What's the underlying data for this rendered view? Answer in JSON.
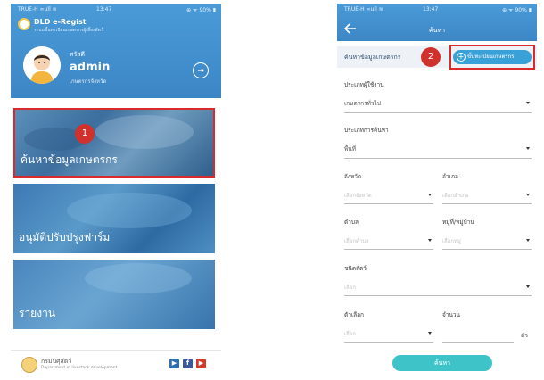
{
  "left_screen": {
    "status_bar": {
      "left": "TRUE-H ∞ull ≋",
      "time": "13:47",
      "right": "⊕ ᯤ 90% ▮"
    },
    "app_title": "DLD e-Regist",
    "app_subtitle": "ระบบขึ้นทะเบียนเกษตรกรผู้เลี้ยงสัตว์",
    "user": {
      "role": "สวัสดี",
      "name": "admin",
      "department": "เกษตรกรจังหวัด"
    },
    "tiles": [
      {
        "label": "ค้นหาข้อมูลเกษตรกร",
        "marker": "1"
      },
      {
        "label": "อนุมัติปรับปรุงฟาร์ม"
      },
      {
        "label": "รายงาน"
      }
    ],
    "footer": {
      "dept_name": "กรมปศุสัตว์",
      "dept_sub": "Department of livestock development",
      "social": [
        "▶",
        "f",
        "▶"
      ]
    }
  },
  "right_screen": {
    "status_bar": {
      "left": "TRUE-H ∞ull ≋",
      "time": "13:47",
      "right": "⊕ ᯤ 90% ▮"
    },
    "title": "ค้นหา",
    "section_title": "ค้นหาข้อมูลเกษตรกร",
    "register_button": "ขึ้นทะเบียนเกษตรกร",
    "marker": "2",
    "form": {
      "user_type_label": "ประเภทผู้ใช้งาน",
      "user_type_value": "เกษตรกรทั่วไป",
      "search_type_label": "ประเภทการค้นหา",
      "search_type_value": "พื้นที่",
      "province_label": "จังหวัด",
      "province_placeholder": "เลือกจังหวัด",
      "district_label": "อำเภอ",
      "district_placeholder": "เลือกอำเภอ",
      "subdistrict_label": "ตำบล",
      "subdistrict_placeholder": "เลือกตำบล",
      "village_label": "หมู่ที่/หมู่บ้าน",
      "village_placeholder": "เลือกหมู่",
      "animal_label": "ชนิดสัตว์",
      "animal_placeholder": "เลือก",
      "option_label": "ตัวเลือก",
      "option_placeholder": "เลือก",
      "amount_label": "จำนวน",
      "amount_unit": "ตัว",
      "search_button": "ค้นหา"
    }
  },
  "colors": {
    "header_blue": "#4a9bd8",
    "highlight_red": "#d92b2b",
    "marker_red": "#d0312d",
    "search_teal": "#3ec3c9",
    "register_blue": "#3aa1d8"
  }
}
